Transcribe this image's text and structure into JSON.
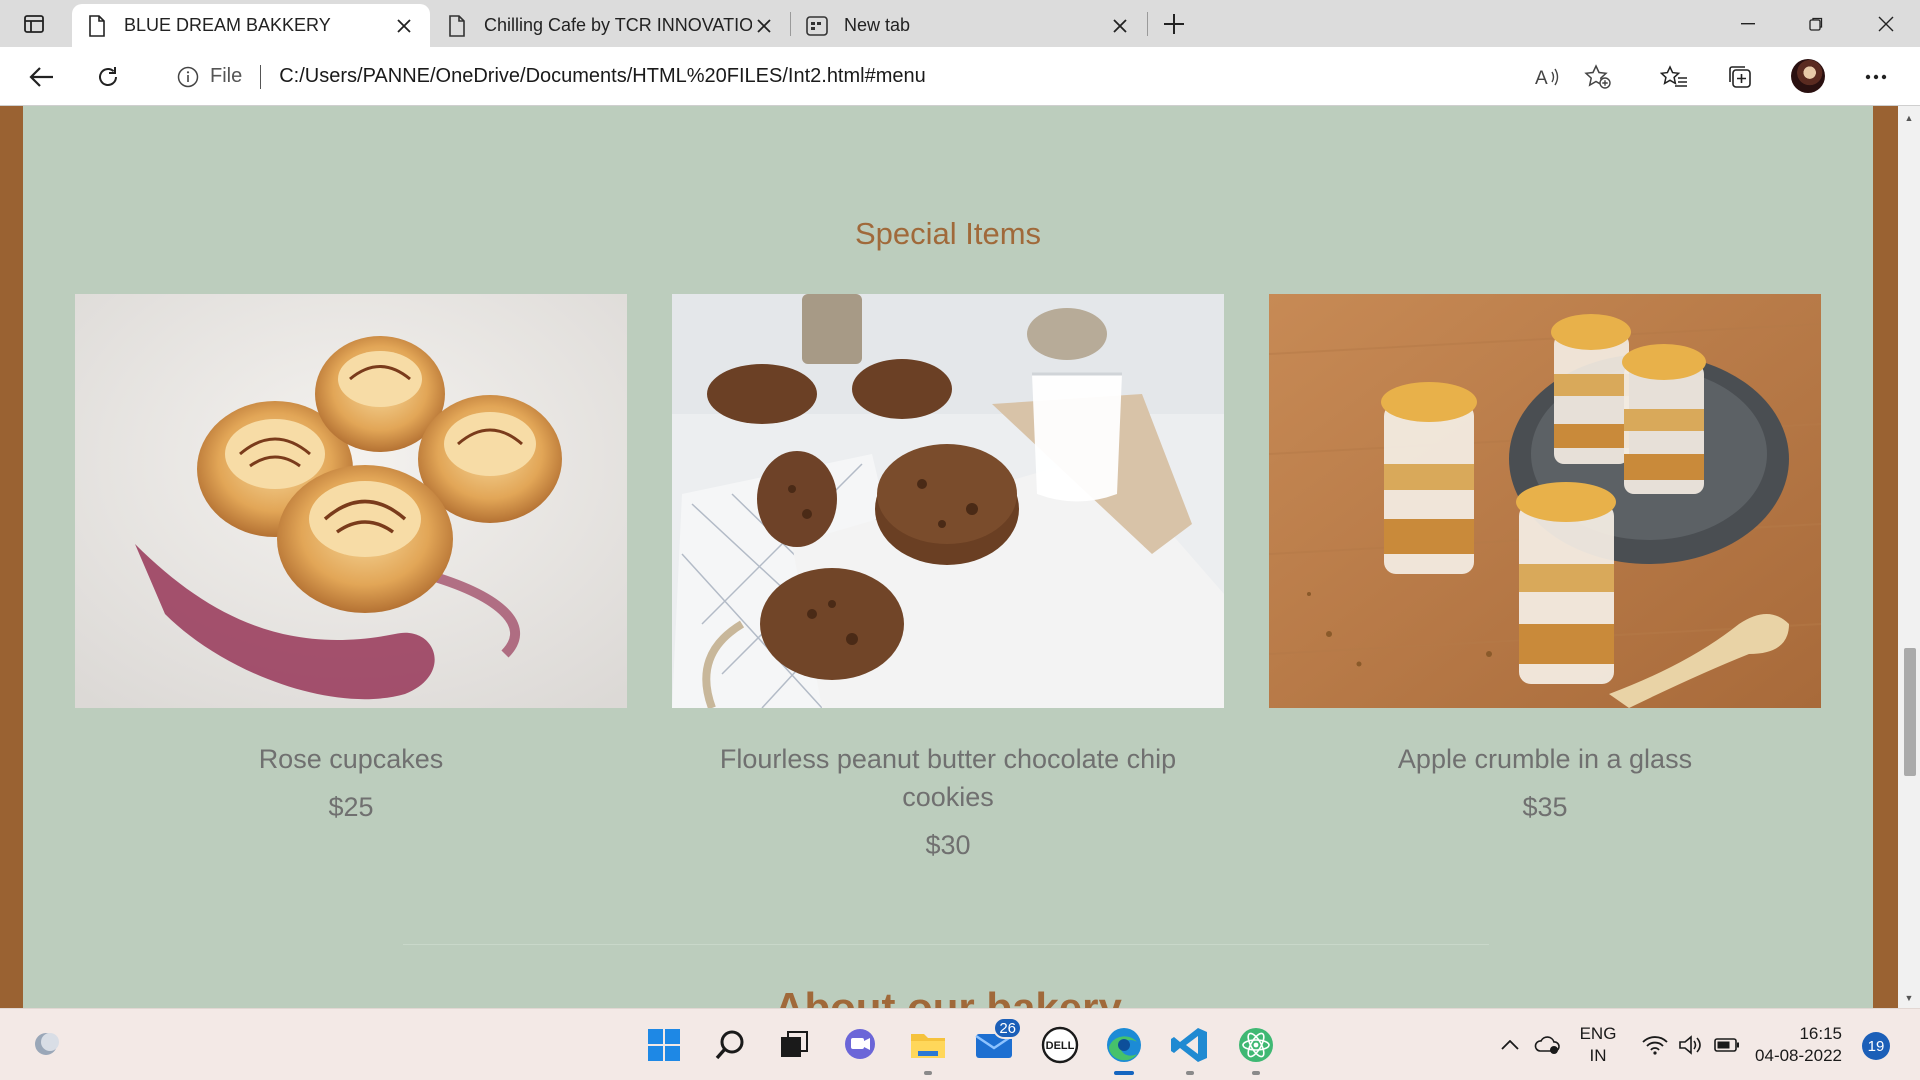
{
  "browser": {
    "tabs": [
      {
        "title": "BLUE DREAM BAKKERY",
        "active": true,
        "icon": "page-icon"
      },
      {
        "title": "Chilling Cafe by TCR INNOVATIO",
        "active": false,
        "icon": "page-icon"
      },
      {
        "title": "New tab",
        "active": false,
        "icon": "newtab-icon"
      }
    ],
    "address": {
      "scheme_label": "File",
      "url": "C:/Users/PANNE/OneDrive/Documents/HTML%20FILES/Int2.html#menu"
    }
  },
  "page": {
    "section_title": "Special Items",
    "items": [
      {
        "name": "Rose cupcakes",
        "price": "$25"
      },
      {
        "name": "Flourless peanut butter chocolate chip cookies",
        "price": "$30"
      },
      {
        "name": "Apple crumble in a glass",
        "price": "$35"
      }
    ],
    "next_section_title": "About our bakery",
    "colors": {
      "background": "#bccdbd",
      "frame": "#9a6232",
      "title": "#a0693a",
      "text": "#707070"
    }
  },
  "taskbar": {
    "mail_badge": "26",
    "language": {
      "line1": "ENG",
      "line2": "IN"
    },
    "time": "16:15",
    "date": "04-08-2022",
    "notifications": "19"
  }
}
